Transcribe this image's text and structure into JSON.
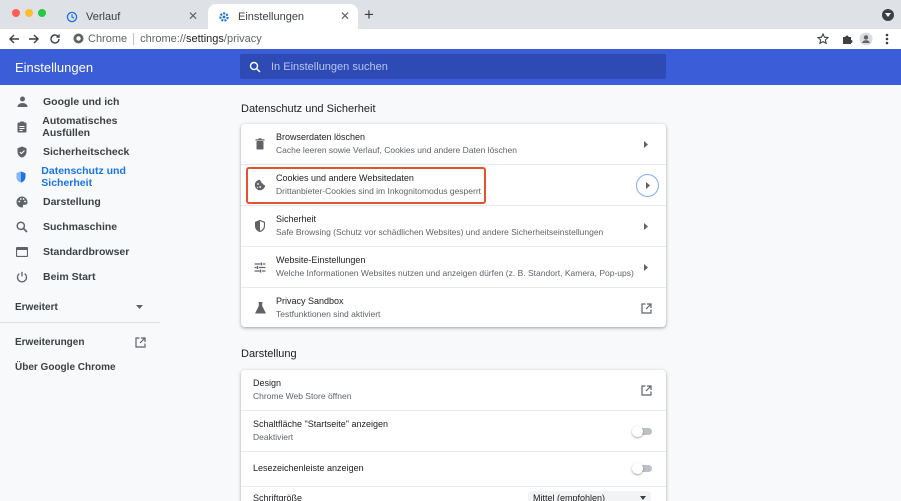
{
  "tabs": [
    {
      "label": "Verlauf",
      "icon": "history-icon"
    },
    {
      "label": "Einstellungen",
      "icon": "settings-gear-icon"
    }
  ],
  "omnibox": {
    "site_label": "Chrome",
    "url_scheme": "chrome://",
    "url_host": "settings",
    "url_path": "/privacy"
  },
  "header": {
    "title": "Einstellungen",
    "search_placeholder": "In Einstellungen suchen"
  },
  "sidebar": {
    "items": [
      {
        "label": "Google und ich",
        "icon": "person-icon"
      },
      {
        "label": "Automatisches Ausfüllen",
        "icon": "clipboard-icon"
      },
      {
        "label": "Sicherheitscheck",
        "icon": "shield-check-icon"
      },
      {
        "label": "Datenschutz und Sicherheit",
        "icon": "privacy-shield-icon"
      },
      {
        "label": "Darstellung",
        "icon": "palette-icon"
      },
      {
        "label": "Suchmaschine",
        "icon": "search-icon"
      },
      {
        "label": "Standardbrowser",
        "icon": "browser-icon"
      },
      {
        "label": "Beim Start",
        "icon": "power-icon"
      }
    ],
    "advanced": "Erweitert",
    "extensions": "Erweiterungen",
    "about": "Über Google Chrome"
  },
  "privacy": {
    "title": "Datenschutz und Sicherheit",
    "rows": [
      {
        "title": "Browserdaten löschen",
        "sub": "Cache leeren sowie Verlauf, Cookies und andere Daten löschen"
      },
      {
        "title": "Cookies und andere Websitedaten",
        "sub": "Drittanbieter-Cookies sind im Inkognitomodus gesperrt"
      },
      {
        "title": "Sicherheit",
        "sub": "Safe Browsing (Schutz vor schädlichen Websites) und andere Sicherheitseinstellungen"
      },
      {
        "title": "Website-Einstellungen",
        "sub": "Welche Informationen Websites nutzen und anzeigen dürfen (z. B. Standort, Kamera, Pop-ups)"
      },
      {
        "title": "Privacy Sandbox",
        "sub": "Testfunktionen sind aktiviert"
      }
    ]
  },
  "appearance": {
    "title": "Darstellung",
    "rows": [
      {
        "title": "Design",
        "sub": "Chrome Web Store öffnen"
      },
      {
        "title": "Schaltfläche \"Startseite\" anzeigen",
        "sub": "Deaktiviert"
      },
      {
        "title": "Lesezeichenleiste anzeigen",
        "sub": ""
      },
      {
        "title": "Schriftgröße",
        "sub": "",
        "value": "Mittel (empfohlen)"
      }
    ],
    "home_button_on": false,
    "bookmarks_bar_on": false
  },
  "colors": {
    "accent": "#3b5ed8",
    "active_nav": "#1a73e8",
    "highlight": "#e5522d"
  }
}
